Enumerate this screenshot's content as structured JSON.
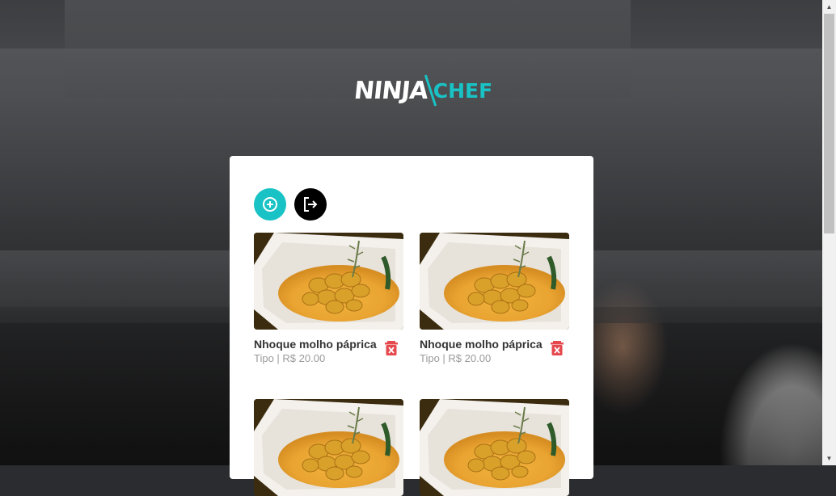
{
  "brand": {
    "logo_left": "NINJA",
    "logo_right": "CHEF"
  },
  "actions": {
    "add_icon": "plus-circle-icon",
    "logout_icon": "logout-icon"
  },
  "dishes": [
    {
      "name": "Nhoque molho páprica",
      "subtitle": "Tipo | R$ 20.00"
    },
    {
      "name": "Nhoque molho páprica",
      "subtitle": "Tipo | R$ 20.00"
    },
    {
      "name": "",
      "subtitle": ""
    },
    {
      "name": "",
      "subtitle": ""
    }
  ],
  "colors": {
    "accent": "#19c3c5",
    "delete": "#e5484d",
    "logout": "#000000"
  }
}
